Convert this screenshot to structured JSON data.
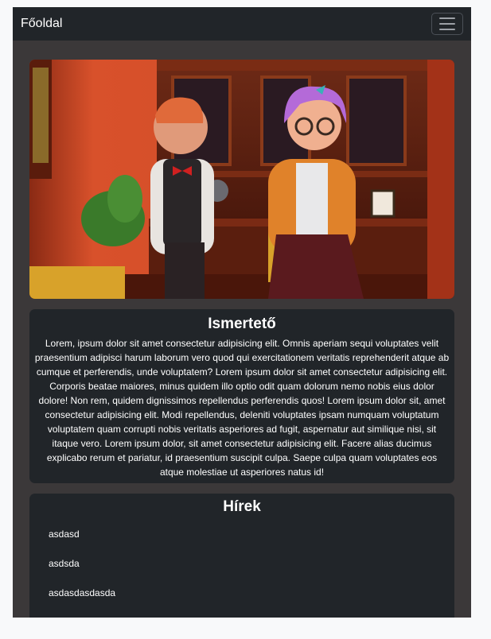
{
  "navbar": {
    "brand": "Főoldal",
    "menu_icon": "hamburger-menu-icon"
  },
  "hero": {
    "description": "3D animated scene: a red-haired man in a vest and bow tie and a purple-haired woman with glasses in an office with wooden cabinets"
  },
  "about": {
    "title": "Ismertető",
    "text": "Lorem, ipsum dolor sit amet consectetur adipisicing elit. Omnis aperiam sequi voluptates velit praesentium adipisci harum laborum vero quod qui exercitationem veritatis reprehenderit atque ab cumque et perferendis, unde voluptatem? Lorem ipsum dolor sit amet consectetur adipisicing elit. Corporis beatae maiores, minus quidem illo optio odit quam dolorum nemo nobis eius dolor dolore! Non rem, quidem dignissimos repellendus perferendis quos! Lorem ipsum dolor sit, amet consectetur adipisicing elit. Modi repellendus, deleniti voluptates ipsam numquam voluptatum voluptatem quam corrupti nobis veritatis asperiores ad fugit, aspernatur aut similique nisi, sit itaque vero. Lorem ipsum dolor, sit amet consectetur adipisicing elit. Facere alias ducimus explicabo rerum et pariatur, id praesentium suscipit culpa. Saepe culpa quam voluptates eos atque molestiae ut asperiores natus id!"
  },
  "news": {
    "title": "Hírek",
    "items": [
      "asdasd",
      "asdsda",
      "asdasdasdasda"
    ]
  }
}
